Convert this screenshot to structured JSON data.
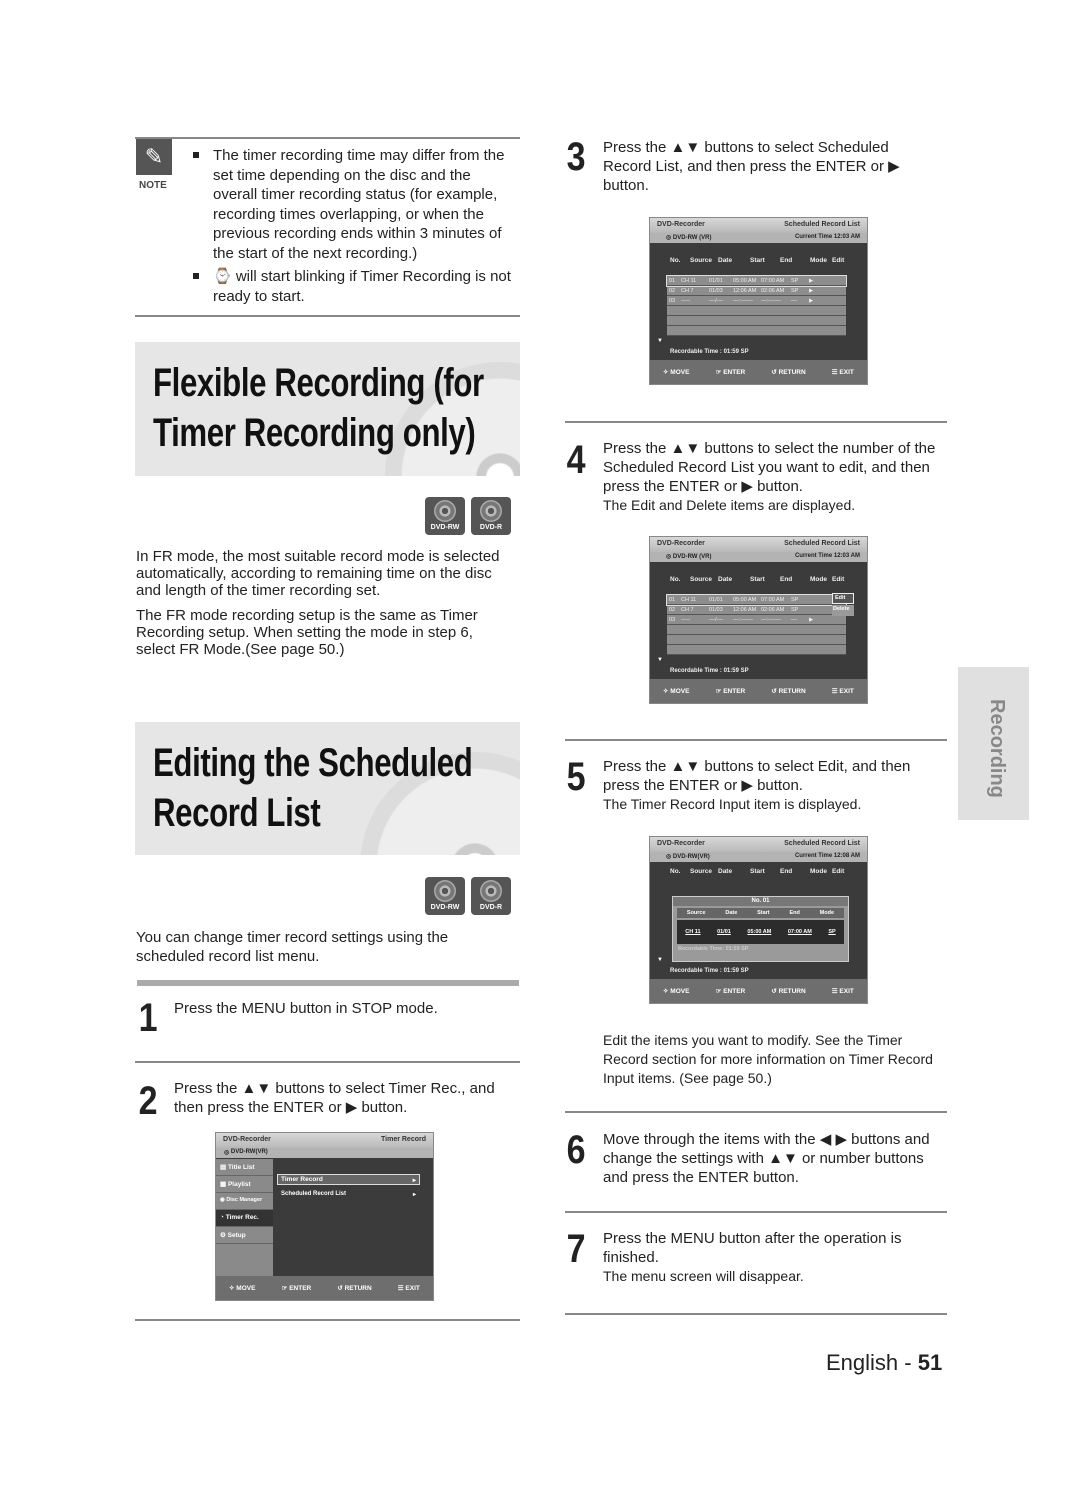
{
  "note": {
    "label": "NOTE",
    "icon": "pencil-icon",
    "lines1": [
      "The timer recording time may differ from the",
      "set time depending on the disc and the",
      "overall timer recording status (for example,",
      "recording times overlapping, or when the",
      "previous recording ends within 3 minutes of",
      "the start of the next recording.)"
    ],
    "lines2": [
      "⌚ will start blinking if Timer Recording is not",
      "ready to start."
    ]
  },
  "section1": {
    "title": [
      "Flexible Recording (for",
      "Timer Recording only)"
    ],
    "badges": [
      "DVD-RW",
      "DVD-R"
    ],
    "para1": [
      "In FR mode, the most suitable record mode is selected",
      "automatically, according to remaining time on the disc",
      "and length of the timer recording set."
    ],
    "para2": [
      "The FR mode recording setup is the same as Timer",
      "Recording setup. When setting the mode in step 6,",
      "select FR Mode.(See page 50.)"
    ]
  },
  "section2": {
    "title": [
      "Editing the Scheduled",
      "Record List"
    ],
    "badges": [
      "DVD-RW",
      "DVD-R"
    ],
    "intro": [
      "You can change timer record settings using the",
      "scheduled record list menu."
    ]
  },
  "steps": [
    {
      "num": "1",
      "lines": [
        "Press the MENU button in STOP mode."
      ]
    },
    {
      "num": "2",
      "lines": [
        "Press the ▲▼ buttons to select Timer Rec., and",
        "then press the ENTER or ▶ button."
      ]
    },
    {
      "num": "3",
      "lines": [
        "Press the ▲▼ buttons to select Scheduled",
        "Record List, and then press the ENTER or ▶",
        "button."
      ]
    },
    {
      "num": "4",
      "lines": [
        "Press the ▲▼ buttons to select the number of the",
        "Scheduled Record List you want to edit, and then",
        "press the ENTER or ▶ button."
      ],
      "sub": "The Edit and Delete items are displayed."
    },
    {
      "num": "5",
      "lines": [
        "Press the ▲▼ buttons to select Edit, and then",
        "press the ENTER or ▶ button."
      ],
      "sub": "The Timer Record Input item is displayed.",
      "after": [
        "Edit the items you want to modify. See the Timer",
        "Record section for more information on Timer Record",
        "Input items. (See page 50.)"
      ]
    },
    {
      "num": "6",
      "lines": [
        "Move through the items with the ◀ ▶ buttons and",
        "change the settings with ▲▼ or number buttons",
        "and press the ENTER button."
      ]
    },
    {
      "num": "7",
      "lines": [
        "Press the MENU button after the operation is",
        "finished."
      ],
      "sub": "The menu screen will disappear."
    }
  ],
  "screen_common": {
    "brand": "DVD-Recorder",
    "footer": [
      "✧ MOVE",
      "☞ ENTER",
      "↺ RETURN",
      "☰ EXIT"
    ],
    "columns": [
      "No.",
      "Source",
      "Date",
      "Start",
      "End",
      "Mode",
      "Edit"
    ],
    "rows": [
      [
        "01",
        "CH 11",
        "01/01",
        "05:00 AM",
        "07:00 AM",
        "SP",
        "▶"
      ],
      [
        "02",
        "CH 7",
        "01/03",
        "12:06 AM",
        "02:06 AM",
        "SP",
        "▶"
      ],
      [
        "03",
        "–––",
        "––/––",
        "––:––––",
        "––:––––",
        "––",
        "▶"
      ]
    ],
    "recordable": "Recordable Time : 01:59  SP"
  },
  "screen_menu": {
    "title": "Timer Record",
    "disc": "DVD-RW(VR)",
    "sidebar": [
      "Title List",
      "Playlist",
      "Disc Manager",
      "Timer Rec.",
      "Setup"
    ],
    "items": [
      "Timer Record",
      "Scheduled Record List"
    ]
  },
  "screen_list": {
    "title": "Scheduled Record List",
    "disc": "DVD-RW (VR)",
    "time": "Current Time  12:03 AM"
  },
  "screen_edit": {
    "popup": [
      "Edit",
      "Delete"
    ]
  },
  "screen_input": {
    "disc": "DVD-RW(VR)",
    "time": "Current Time  12:08 AM",
    "no": "No. 01",
    "cols": [
      "Source",
      "Date",
      "Start",
      "End",
      "Mode"
    ],
    "vals": [
      "CH 11",
      "01/01",
      "05:00 AM",
      "07:00 AM",
      "SP"
    ],
    "inner_recordable": "Recordable Time: 01:59 SP",
    "recordable": "Recordable Time : 01:59  SP"
  },
  "side_tab": "Recording",
  "footer": {
    "language": "English - ",
    "page": "51"
  }
}
